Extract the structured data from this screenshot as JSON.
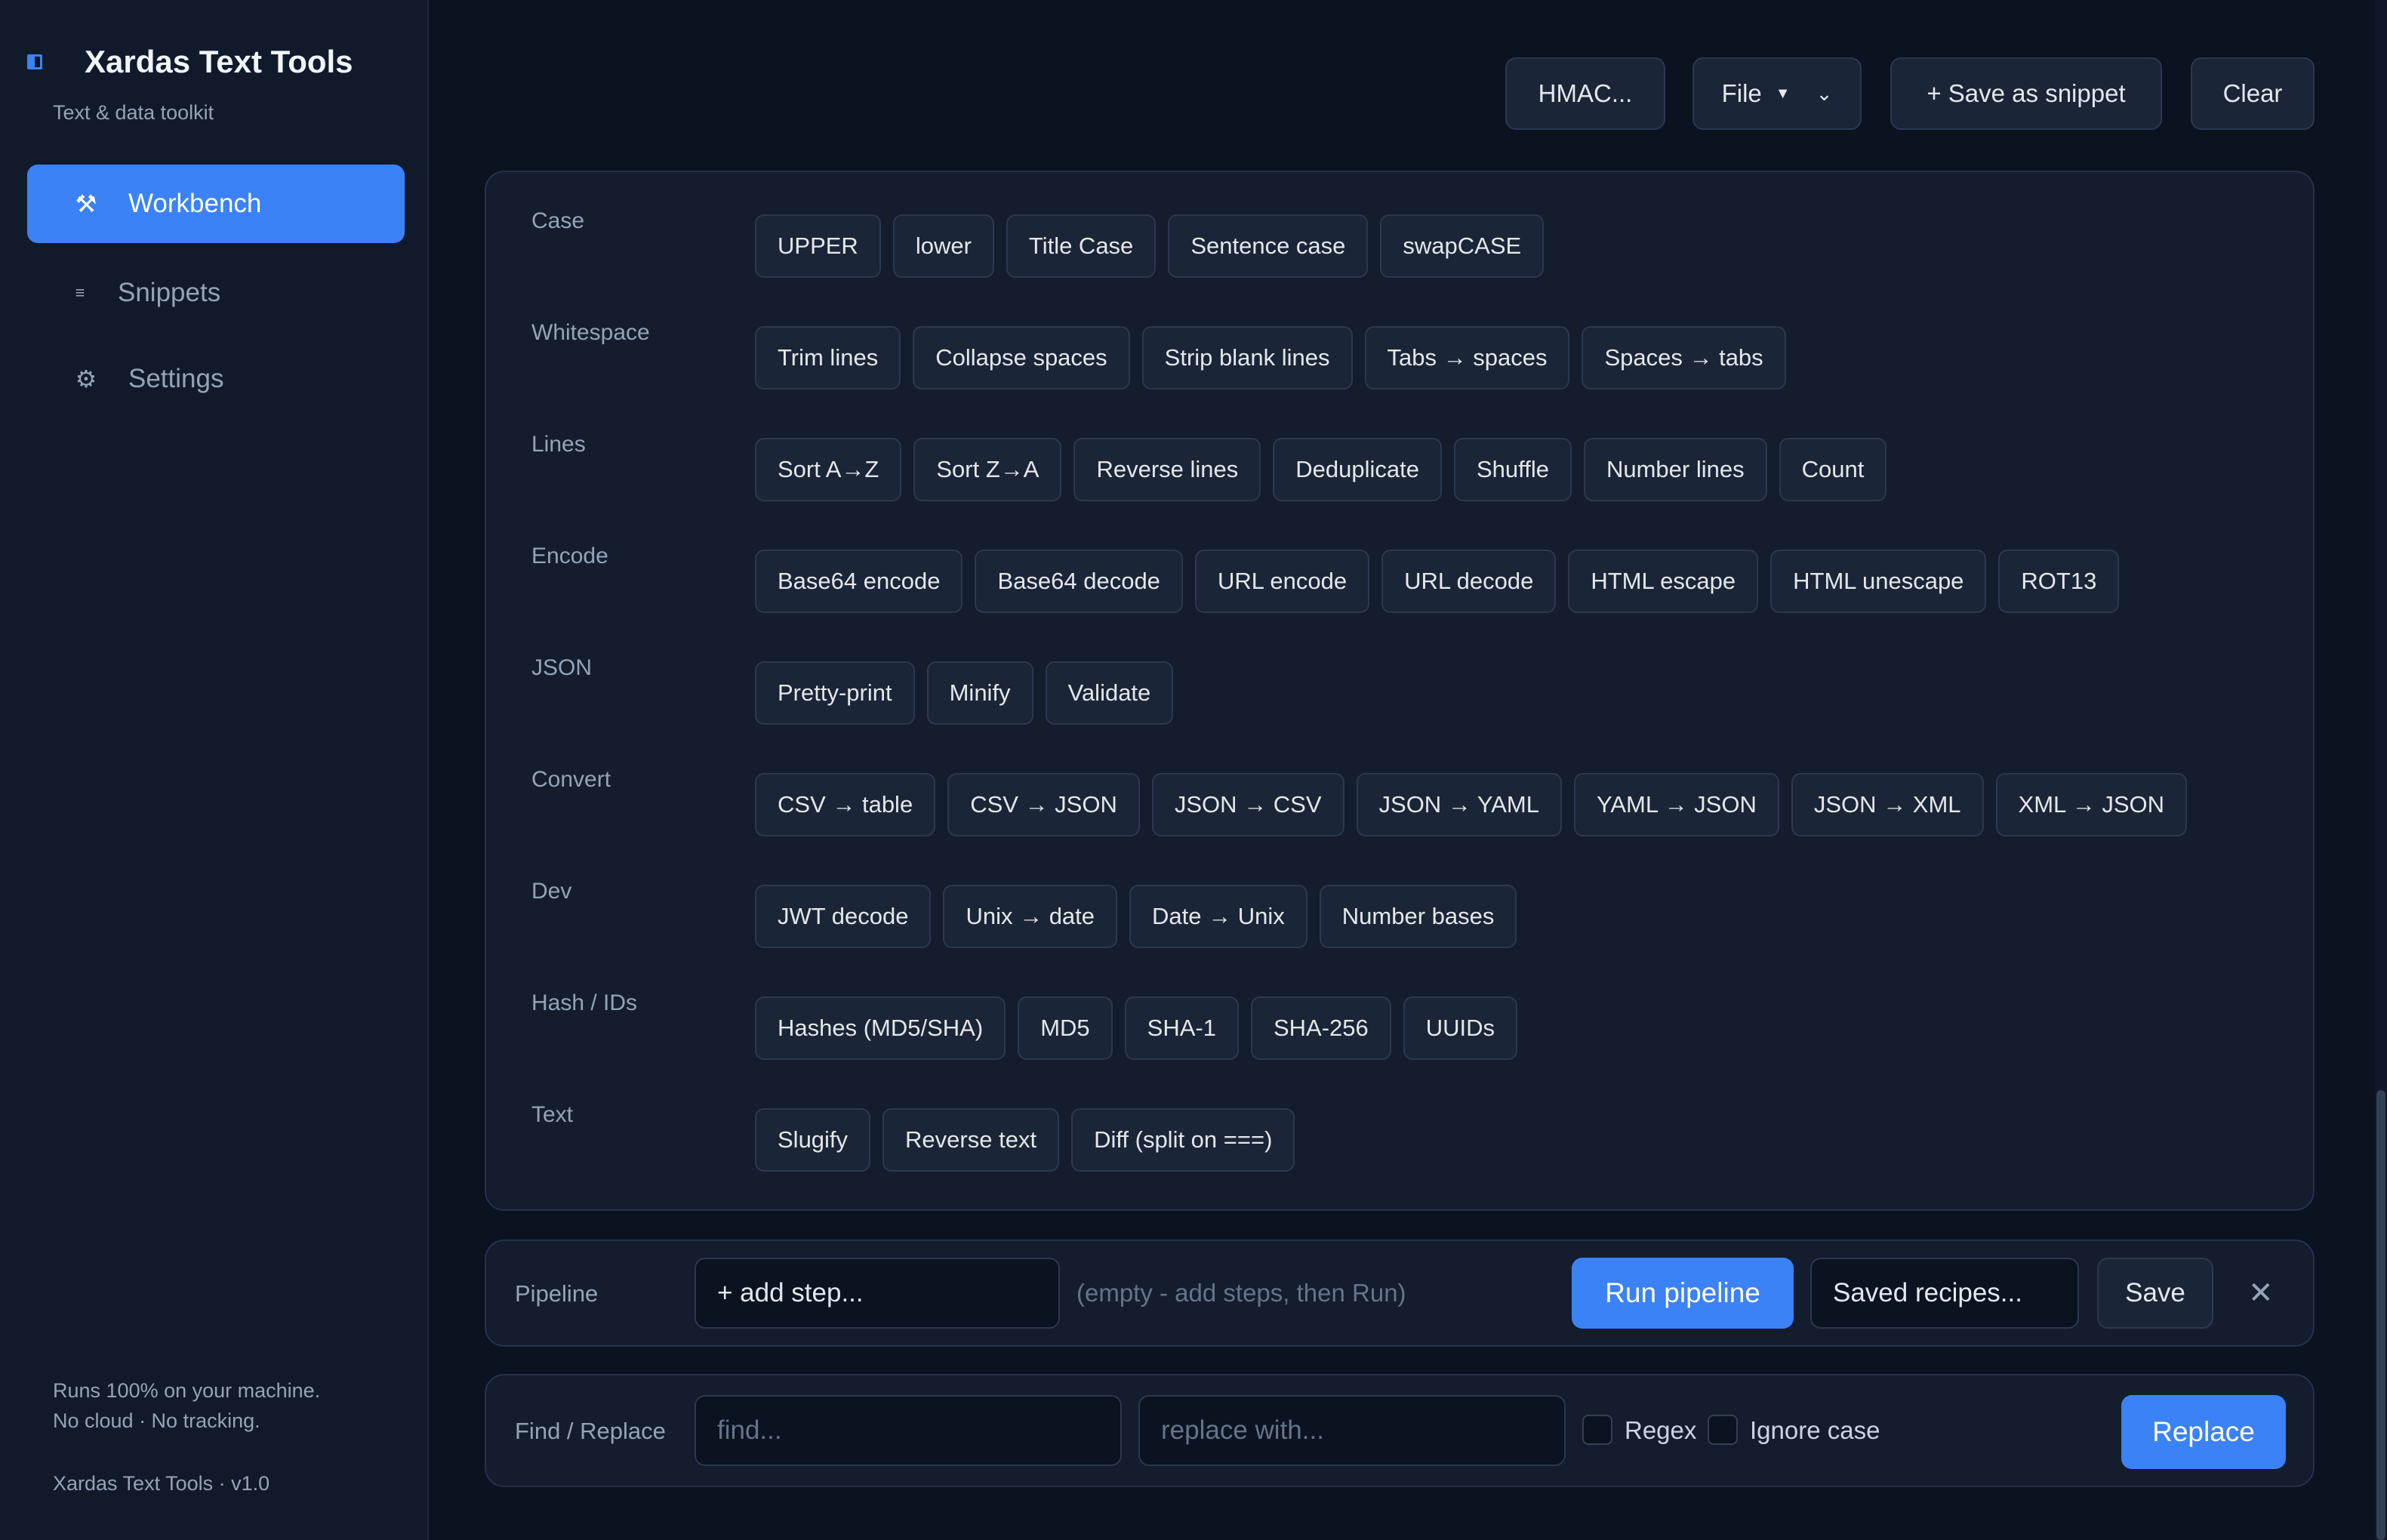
{
  "app": {
    "title": "Xardas Text Tools",
    "subtitle": "Text & data toolkit",
    "footer_note_1": "Runs 100% on your machine.",
    "footer_note_2": "No cloud · No tracking.",
    "version": "Xardas Text Tools · v1.0"
  },
  "sidebar": {
    "items": [
      {
        "label": "Workbench",
        "icon": "tools-icon",
        "active": true
      },
      {
        "label": "Snippets",
        "icon": "list-icon",
        "active": false
      },
      {
        "label": "Settings",
        "icon": "gear-icon",
        "active": false
      }
    ]
  },
  "toolbar": {
    "hmac_label": "HMAC...",
    "file_label": "File",
    "save_snippet_label": "+ Save as snippet",
    "clear_label": "Clear"
  },
  "tools": [
    {
      "group": "Case",
      "items": [
        "UPPER",
        "lower",
        "Title Case",
        "Sentence case",
        "swapCASE"
      ]
    },
    {
      "group": "Whitespace",
      "items": [
        "Trim lines",
        "Collapse spaces",
        "Strip blank lines",
        "Tabs → spaces",
        "Spaces → tabs"
      ]
    },
    {
      "group": "Lines",
      "items": [
        "Sort A→Z",
        "Sort Z→A",
        "Reverse lines",
        "Deduplicate",
        "Shuffle",
        "Number lines",
        "Count"
      ]
    },
    {
      "group": "Encode",
      "items": [
        "Base64 encode",
        "Base64 decode",
        "URL encode",
        "URL decode",
        "HTML escape",
        "HTML unescape",
        "ROT13"
      ]
    },
    {
      "group": "JSON",
      "items": [
        "Pretty-print",
        "Minify",
        "Validate"
      ]
    },
    {
      "group": "Convert",
      "items": [
        "CSV → table",
        "CSV → JSON",
        "JSON → CSV",
        "JSON → YAML",
        "YAML → JSON",
        "JSON → XML",
        "XML → JSON"
      ]
    },
    {
      "group": "Dev",
      "items": [
        "JWT decode",
        "Unix → date",
        "Date → Unix",
        "Number bases"
      ]
    },
    {
      "group": "Hash / IDs",
      "items": [
        "Hashes (MD5/SHA)",
        "MD5",
        "SHA-1",
        "SHA-256",
        "UUIDs"
      ]
    },
    {
      "group": "Text",
      "items": [
        "Slugify",
        "Reverse text",
        "Diff (split on ===)"
      ]
    }
  ],
  "pipeline": {
    "label": "Pipeline",
    "add_step": "+ add step...",
    "empty_hint": "(empty - add steps, then Run)",
    "run_label": "Run pipeline",
    "recipes_label": "Saved recipes...",
    "save_label": "Save",
    "close_glyph": "✕"
  },
  "find_replace": {
    "label": "Find / Replace",
    "find_placeholder": "find...",
    "replace_placeholder": "replace with...",
    "regex_label": "Regex",
    "ignore_case_label": "Ignore case",
    "replace_button": "Replace"
  },
  "colors": {
    "accent": "#3b82f6",
    "background": "#0b1220",
    "panel": "#131d2e",
    "sidebar": "#111a2b"
  }
}
